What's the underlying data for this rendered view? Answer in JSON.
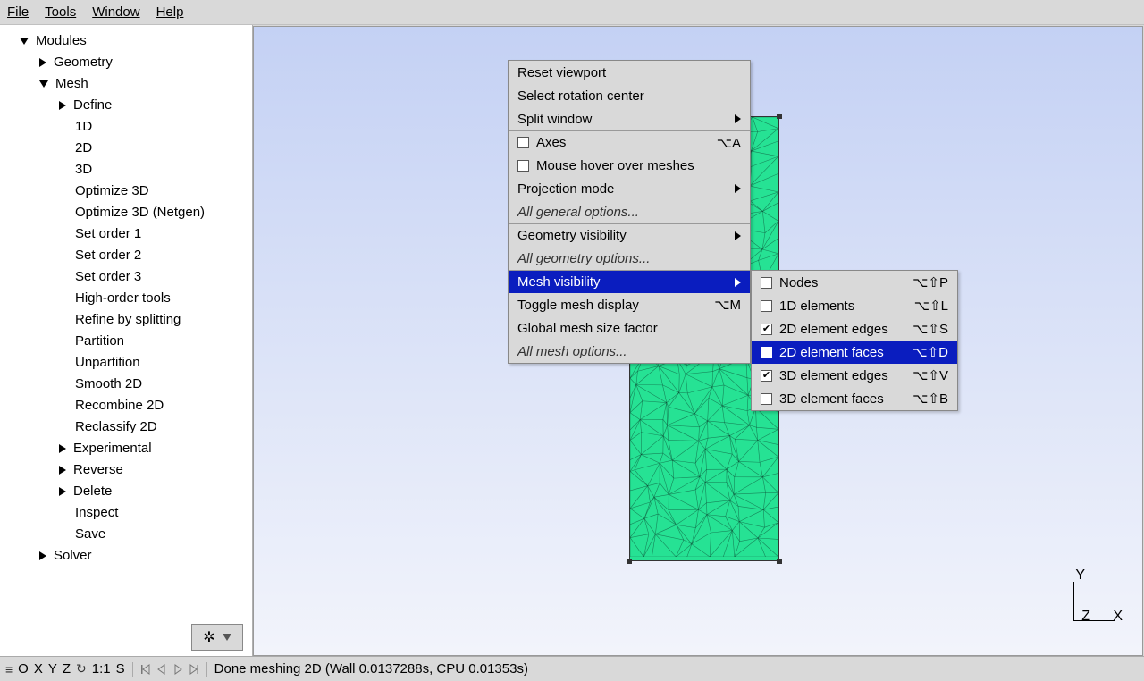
{
  "menubar": {
    "file": "File",
    "tools": "Tools",
    "window": "Window",
    "help": "Help"
  },
  "tree": {
    "root": "Modules",
    "geometry": "Geometry",
    "mesh": "Mesh",
    "mesh_items": [
      "Define",
      "1D",
      "2D",
      "3D",
      "Optimize 3D",
      "Optimize 3D (Netgen)",
      "Set order 1",
      "Set order 2",
      "Set order 3",
      "High-order tools",
      "Refine by splitting",
      "Partition",
      "Unpartition",
      "Smooth 2D",
      "Recombine 2D",
      "Reclassify 2D",
      "Experimental",
      "Reverse",
      "Delete",
      "Inspect",
      "Save"
    ],
    "solver": "Solver"
  },
  "ctx1": {
    "reset_viewport": "Reset viewport",
    "select_rotation": "Select rotation center",
    "split_window": "Split window",
    "axes": "Axes",
    "axes_key": "⌥A",
    "mouse_hover": "Mouse hover over meshes",
    "projection": "Projection mode",
    "all_general": "All general options...",
    "geom_vis": "Geometry visibility",
    "all_geom": "All geometry options...",
    "mesh_vis": "Mesh visibility",
    "toggle_mesh": "Toggle mesh display",
    "toggle_mesh_key": "⌥M",
    "global_size": "Global mesh size factor",
    "all_mesh": "All mesh options..."
  },
  "ctx2": {
    "nodes": "Nodes",
    "nodes_key": "⌥⇧P",
    "d1": "1D elements",
    "d1_key": "⌥⇧L",
    "d2e": "2D element edges",
    "d2e_key": "⌥⇧S",
    "d2f": "2D element faces",
    "d2f_key": "⌥⇧D",
    "d3e": "3D element edges",
    "d3e_key": "⌥⇧V",
    "d3f": "3D element faces",
    "d3f_key": "⌥⇧B"
  },
  "axis": {
    "x": "X",
    "y": "Y",
    "z": "Z"
  },
  "status": {
    "buttons": {
      "o": "O",
      "x": "X",
      "y": "Y",
      "z": "Z",
      "scale": "1:1",
      "s": "S"
    },
    "message": "Done meshing 2D (Wall 0.0137288s, CPU 0.01353s)"
  }
}
